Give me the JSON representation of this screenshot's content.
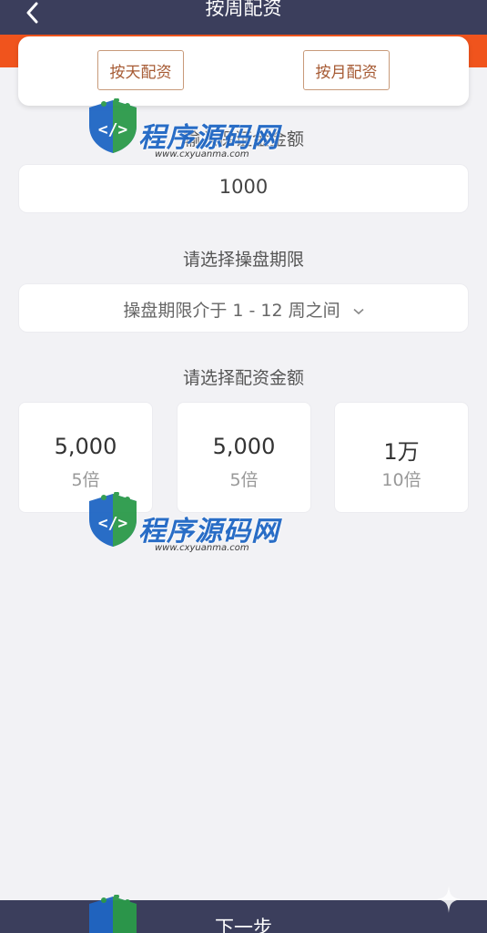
{
  "header": {
    "title": "按周配资"
  },
  "mode_tabs": {
    "daily": "按天配资",
    "monthly": "按月配资"
  },
  "deposit": {
    "label": "输入保证金金额",
    "value": "1000"
  },
  "period": {
    "label": "请选择操盘期限",
    "placeholder": "操盘期限介于 1 - 12 周之间"
  },
  "amount": {
    "label": "请选择配资金额",
    "options": [
      {
        "value": "5,000",
        "multiple": "5倍"
      },
      {
        "value": "5,000",
        "multiple": "5倍"
      },
      {
        "value": "1万",
        "multiple": "10倍"
      }
    ]
  },
  "watermark": {
    "title": "程序源码网",
    "url": "www.cxyuanma.com"
  },
  "footer": {
    "next_label": "下一步"
  },
  "colors": {
    "header_bg": "#3b3e5c",
    "accent_orange": "#f0541d",
    "tab_border": "#c89a7a",
    "tab_text": "#a65a33"
  }
}
